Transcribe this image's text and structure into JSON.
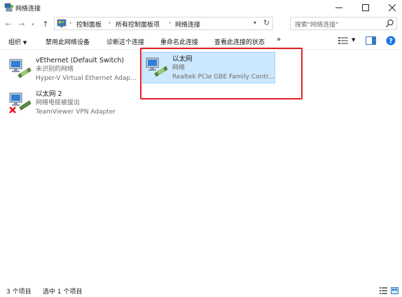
{
  "window": {
    "title": "网络连接"
  },
  "address": {
    "crumbs": [
      "控制面板",
      "所有控制面板项",
      "网络连接"
    ]
  },
  "search": {
    "placeholder": "搜索\"网络连接\""
  },
  "toolbar": {
    "organize": "组织",
    "disable": "禁用此网络设备",
    "diagnose": "诊断这个连接",
    "rename": "重命名此连接",
    "status": "查看此连接的状态",
    "more": "»"
  },
  "connections": [
    {
      "name": "vEthernet (Default Switch)",
      "status": "未识别的网络",
      "device": "Hyper-V Virtual Ethernet Adap...",
      "connected": true,
      "selected": false
    },
    {
      "name": "以太网",
      "status": "网络",
      "device": "Realtek PCIe GBE Family Contr...",
      "connected": true,
      "selected": true
    },
    {
      "name": "以太网 2",
      "status": "网络电缆被拔出",
      "device": "TeamViewer VPN Adapter",
      "connected": false,
      "selected": false
    }
  ],
  "statusbar": {
    "count": "3 个项目",
    "selected": "选中 1 个项目"
  },
  "colors": {
    "selection_bg": "#cce8ff",
    "selection_border": "#99d1ff",
    "highlight": "#e21f26",
    "help_blue": "#1a73e8",
    "error_red": "#e81123"
  }
}
